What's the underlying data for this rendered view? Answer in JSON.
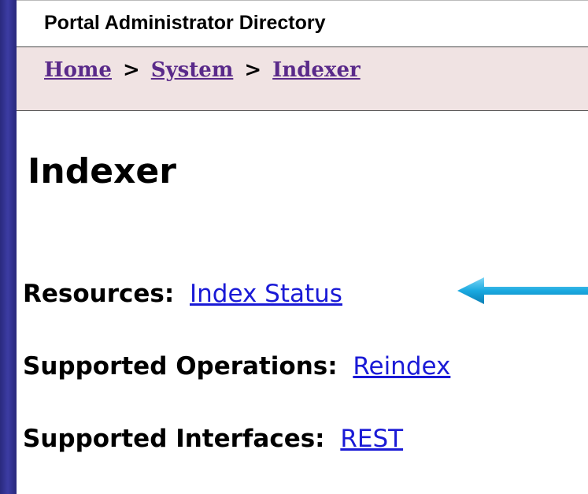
{
  "header": {
    "title": "Portal Administrator Directory"
  },
  "breadcrumb": {
    "items": [
      "Home",
      "System",
      "Indexer"
    ],
    "separator": ">"
  },
  "page": {
    "heading": "Indexer"
  },
  "properties": [
    {
      "label": "Resources:",
      "link": "Index Status"
    },
    {
      "label": "Supported Operations:",
      "link": "Reindex"
    },
    {
      "label": "Supported Interfaces:",
      "link": "REST"
    }
  ],
  "annotation": {
    "arrow_icon": "callout-arrow-icon",
    "arrow_color": "#1aa9e0"
  },
  "colors": {
    "frame": "#2a2a7e",
    "breadcrumb_bg": "#f0e3e3",
    "breadcrumb_link": "#5a2a8a",
    "link": "#1a1ad6"
  }
}
